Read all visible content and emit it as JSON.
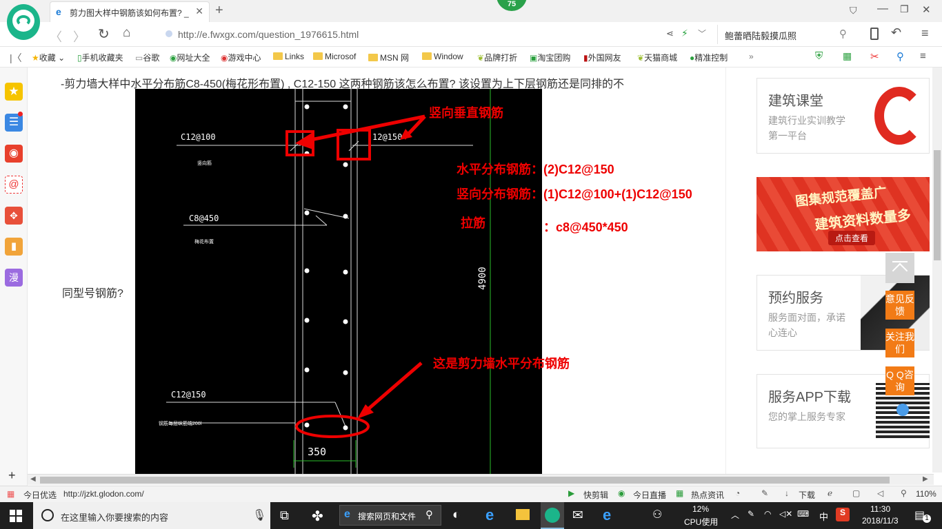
{
  "browser": {
    "update_badge": "75",
    "tab_title": "剪力图大样中钢筋该如何布置? _",
    "url": "http://e.fwxgx.com/question_1976615.html",
    "url_domain": "e.fwxgx.com",
    "search_text": "鲍蕾晒陆毅摸瓜照",
    "bookmarks": [
      "收藏",
      "手机收藏夹",
      "谷歌",
      "网址大全",
      "游戏中心",
      "Links",
      "Microsof",
      "MSN 网",
      "Window",
      "品牌打折",
      "淘宝团购",
      "外国网友",
      "天猫商城",
      "精准控制"
    ]
  },
  "question": {
    "text_line1": "-剪力墙大样中水平分布筋C8-450(梅花形布置)  ,  C12-150 这两种钢筋该怎么布置? 该设置为上下层钢筋还是同排的不",
    "text_line2": "同型号钢筋?"
  },
  "drawing": {
    "label_c12_100": "C12@100",
    "label_small1": "竖向筋",
    "label_c12_150_top": "12@150",
    "label_c8_450": "C8@450",
    "label_small2": "梅花布置",
    "label_c12_150_bottom": "C12@150",
    "label_small3": "钢筋每层纵筋端200l",
    "dim_4900": "4900",
    "dim_350": "350"
  },
  "annotations": {
    "vertical": "竖向垂直钢筋",
    "horizontal": "水平分布钢筋：(2)C12@150",
    "vertical_dist": "竖向分布钢筋：(1)C12@100+(1)C12@150",
    "tie_label": "拉筋",
    "tie_value": "：c8@450*450",
    "shear_wall": "这是剪力墙水平分布钢筋"
  },
  "sidebar_right": {
    "card1_title": "建筑课堂",
    "card1_sub": "建筑行业实训教学第一平台",
    "banner_line1": "图集规范覆盖广",
    "banner_line2": "建筑资料数量多",
    "banner_btn": "点击查看",
    "card2_title": "预约服务",
    "card2_sub": "服务面对面，承诺心连心",
    "card3_title": "服务APP下载",
    "card3_sub": "您的掌上服务专家",
    "float_feedback": "意见反馈",
    "float_follow": "关注我们",
    "float_qq": "Q Q咨询"
  },
  "statusbar": {
    "left_label": "今日优选",
    "link": "http://jzkt.glodon.com/",
    "items": [
      "快剪辑",
      "今日直播",
      "热点资讯",
      "下载"
    ],
    "zoom": "110%"
  },
  "taskbar": {
    "search_placeholder": "在这里输入你要搜索的内容",
    "search_web": "搜索网页和文件",
    "cpu_value": "12%",
    "cpu_label": "CPU使用",
    "lang": "中",
    "time": "11:30",
    "date": "2018/11/3",
    "notify_count": "1"
  }
}
